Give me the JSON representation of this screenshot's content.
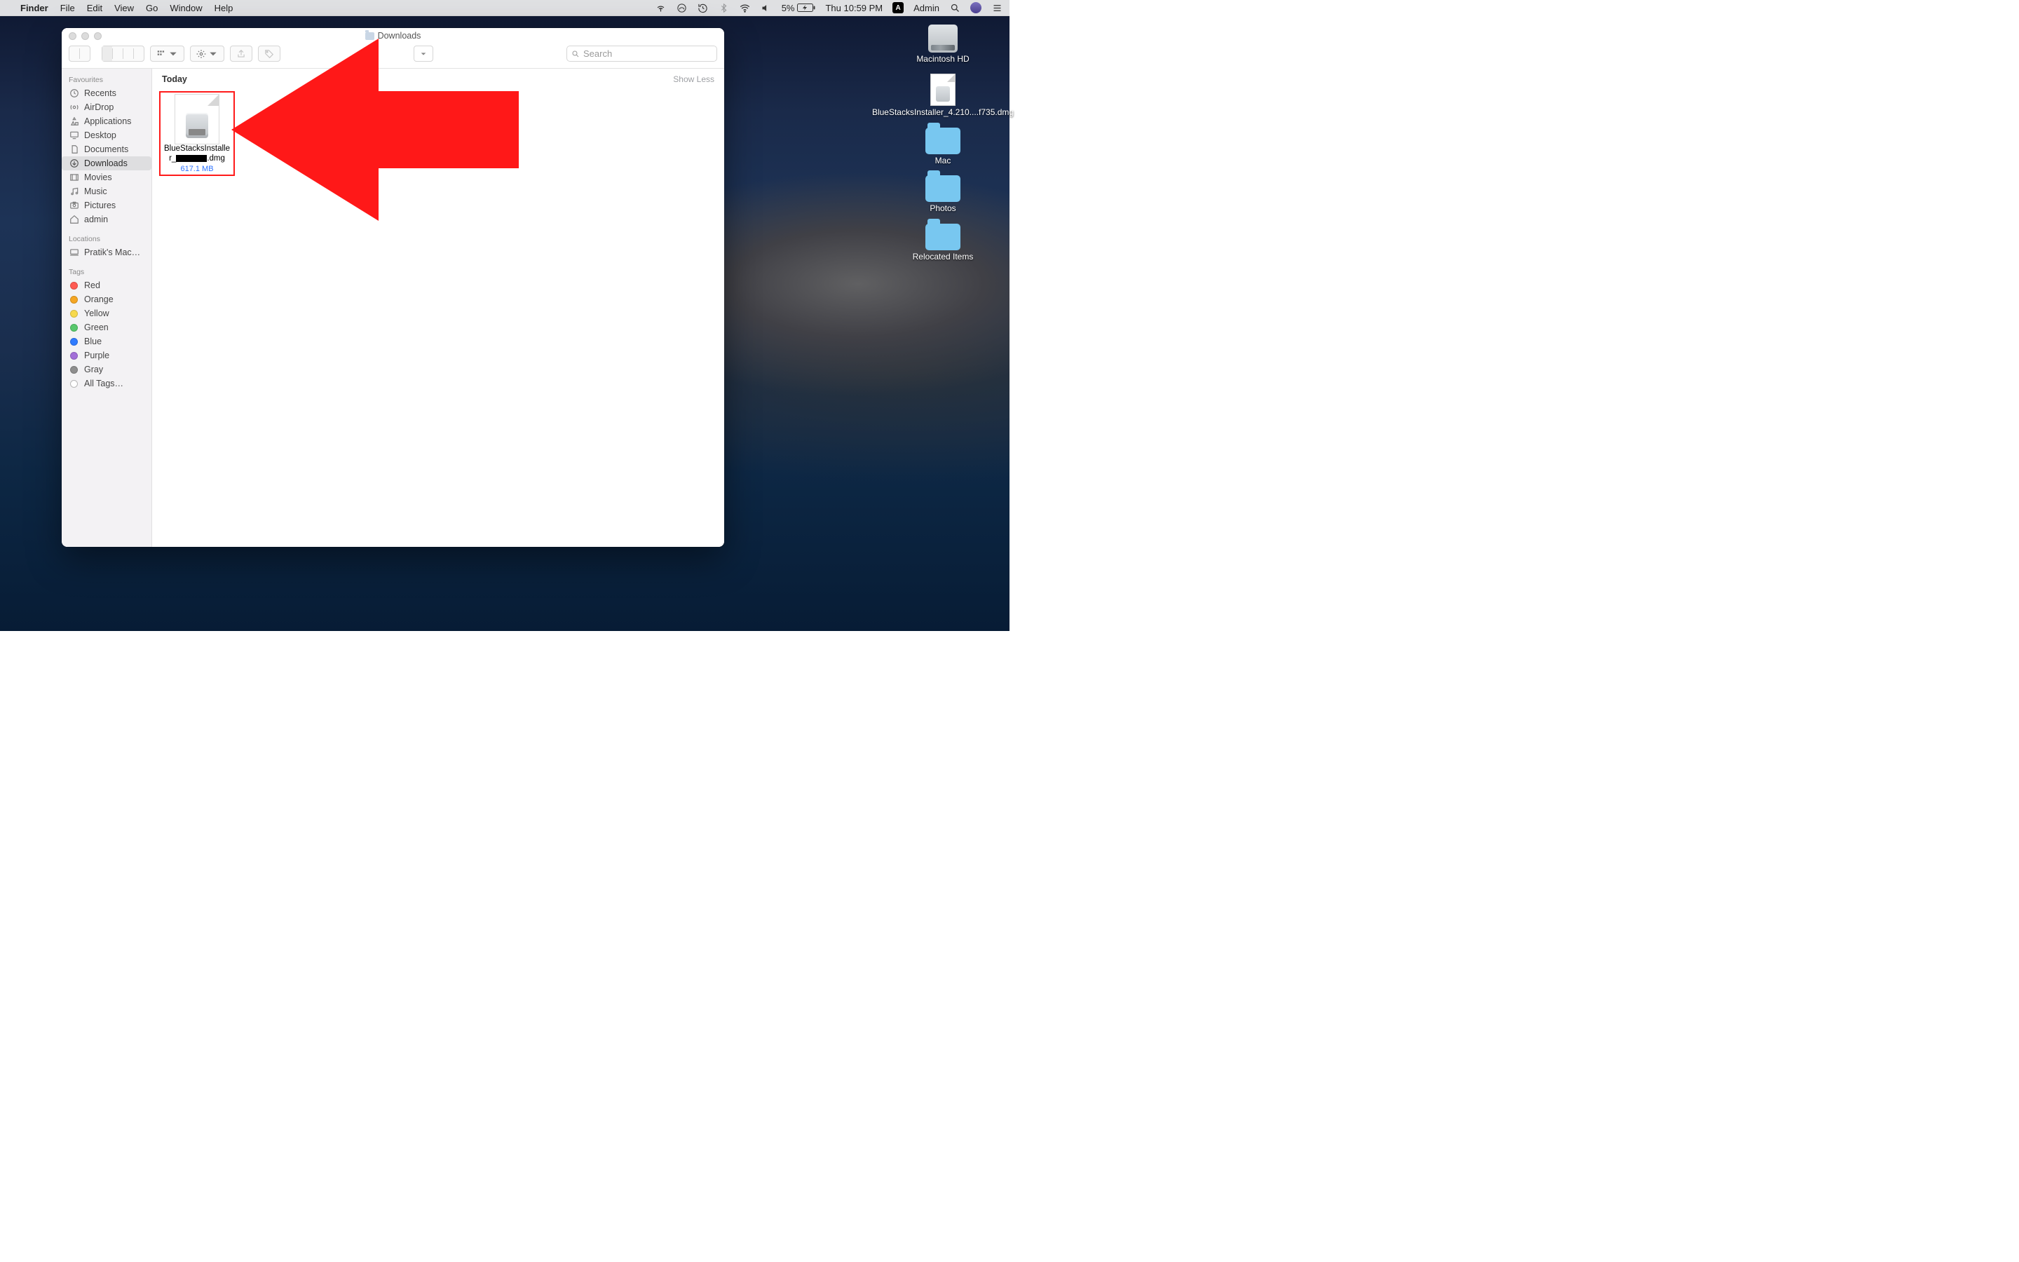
{
  "menubar": {
    "app": "Finder",
    "menus": [
      "File",
      "Edit",
      "View",
      "Go",
      "Window",
      "Help"
    ],
    "battery": "5%",
    "clock": "Thu 10:59 PM",
    "user": "Admin"
  },
  "finder": {
    "title": "Downloads",
    "search_placeholder": "Search",
    "group_header": "Today",
    "show_less": "Show Less",
    "file": {
      "name_line1": "BlueStacksInstalle",
      "name_prefix": "r_",
      "name_suffix": ".dmg",
      "size": "617.1 MB"
    }
  },
  "sidebar": {
    "sections": {
      "favourites": {
        "header": "Favourites",
        "items": [
          "Recents",
          "AirDrop",
          "Applications",
          "Desktop",
          "Documents",
          "Downloads",
          "Movies",
          "Music",
          "Pictures",
          "admin"
        ]
      },
      "locations": {
        "header": "Locations",
        "items": [
          "Pratik's Mac…"
        ]
      },
      "tags": {
        "header": "Tags",
        "items": [
          "Red",
          "Orange",
          "Yellow",
          "Green",
          "Blue",
          "Purple",
          "Gray",
          "All Tags…"
        ]
      }
    }
  },
  "desktop_icons": [
    {
      "kind": "hdd",
      "label": "Macintosh HD"
    },
    {
      "kind": "dmg",
      "label": "BlueStacksInstaller_4.210....f735.dmg"
    },
    {
      "kind": "folder",
      "label": "Mac"
    },
    {
      "kind": "folder",
      "label": "Photos"
    },
    {
      "kind": "folder",
      "label": "Relocated Items"
    }
  ]
}
